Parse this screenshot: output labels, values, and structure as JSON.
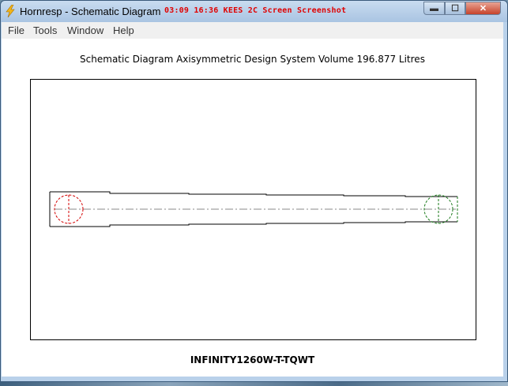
{
  "window": {
    "title": "Hornresp - Schematic Diagram",
    "overlay_text": "03:09  16:36  KEES 2C  Screen Screenshot"
  },
  "titlebar_buttons": {
    "minimize_icon": "minimize-icon",
    "maximize_icon": "maximize-icon",
    "close_icon": "close-icon",
    "minimize_glyph": "▬",
    "maximize_glyph": "☐",
    "close_glyph": "✕"
  },
  "menu": {
    "items": [
      {
        "label": "File"
      },
      {
        "label": "Tools"
      },
      {
        "label": "Window"
      },
      {
        "label": "Help"
      }
    ]
  },
  "content": {
    "heading": "Schematic Diagram   Axisymmetric Design   System Volume 196.877 Litres",
    "footer_label": "INFINITY1260W-T-TQWT"
  },
  "colors": {
    "driver_circle": "#d40000",
    "port_circle": "#1a7a1a",
    "centerline": "#8a8a8a"
  }
}
